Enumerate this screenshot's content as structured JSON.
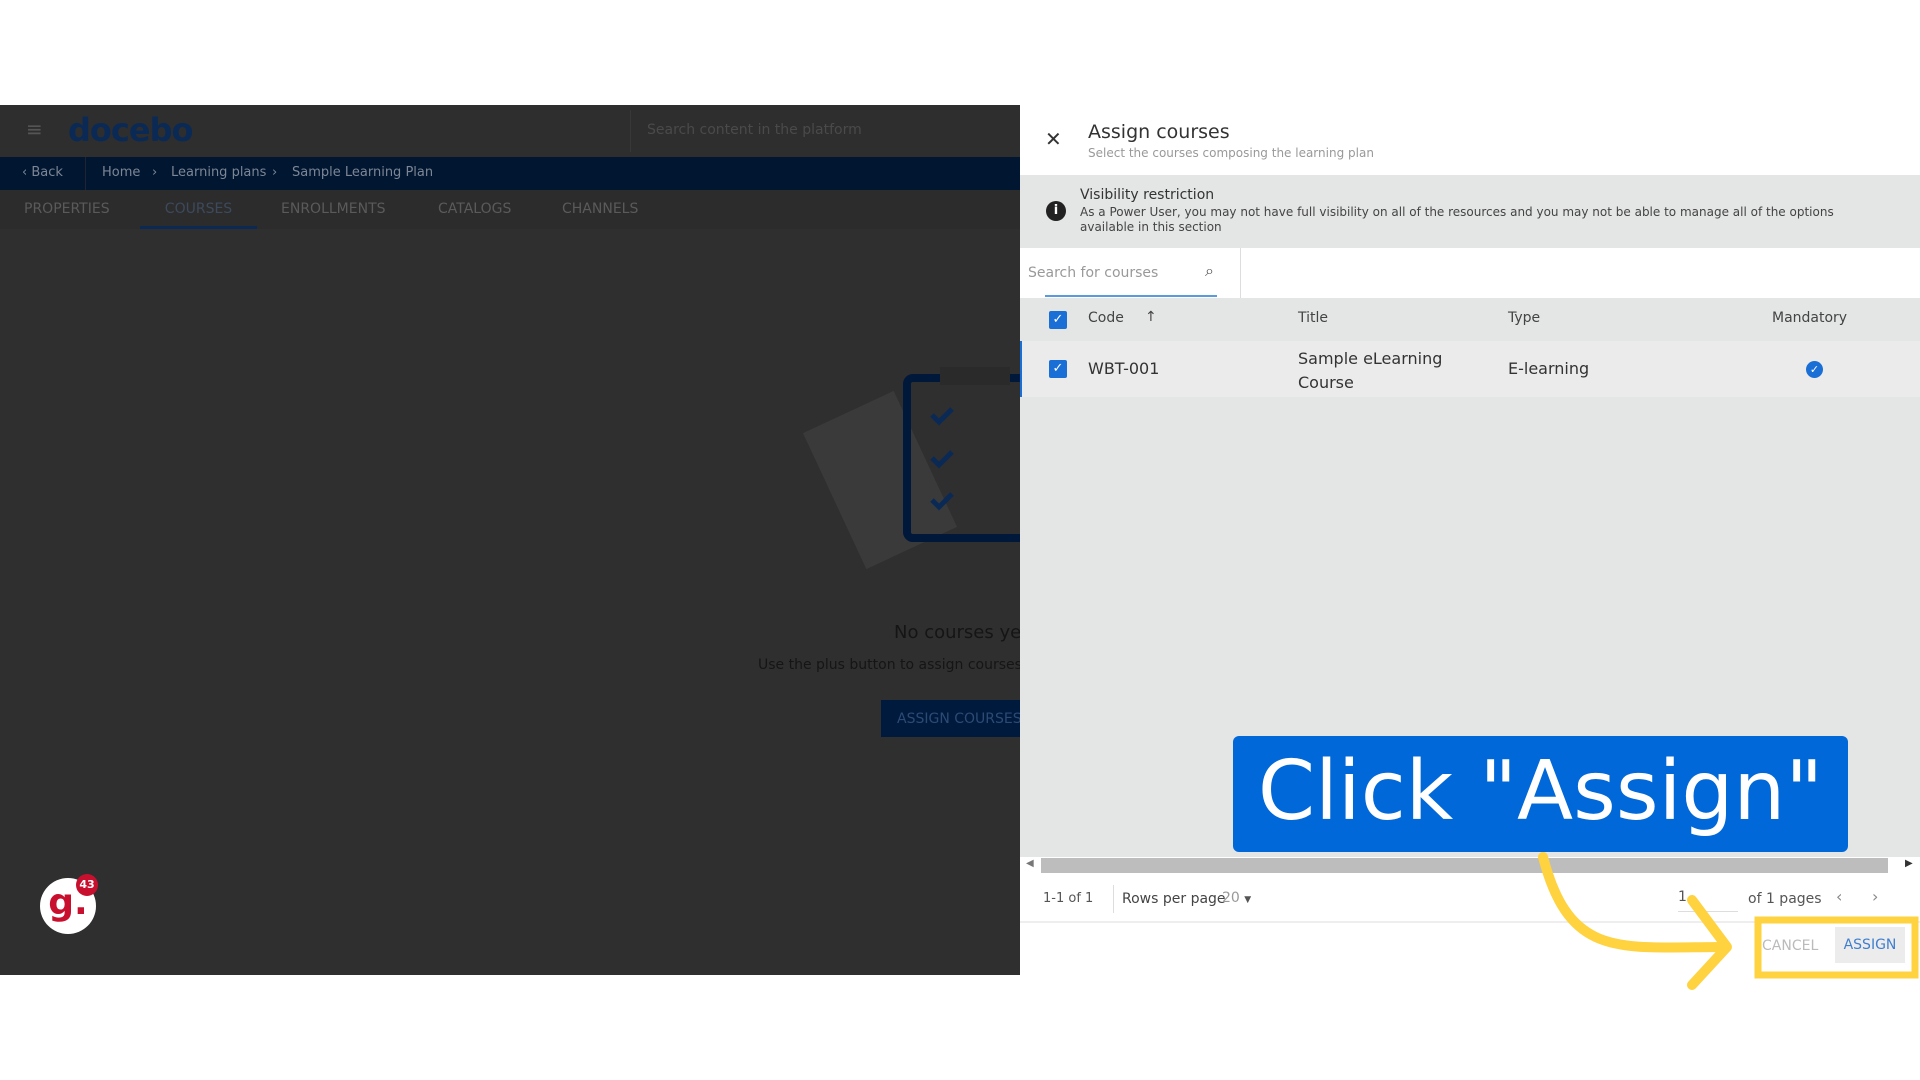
{
  "app": {
    "logo": "docebo",
    "search_placeholder": "Search content in the platform"
  },
  "breadcrumb": {
    "back": "Back",
    "items": [
      "Home",
      "Learning plans",
      "Sample Learning Plan"
    ]
  },
  "tabs": [
    "PROPERTIES",
    "COURSES",
    "ENROLLMENTS",
    "CATALOGS",
    "CHANNELS"
  ],
  "active_tab": "COURSES",
  "empty_state": {
    "title": "No courses yet",
    "subtitle": "Use the plus button to assign courses",
    "button": "ASSIGN COURSES"
  },
  "notification_badge": {
    "letter": "g.",
    "count": "43"
  },
  "panel": {
    "title": "Assign courses",
    "subtitle": "Select the courses composing the learning plan",
    "notice": {
      "title": "Visibility restriction",
      "text": "As a Power User, you may not have full visibility on all of the resources and you may not be able to manage all of the options available in this section"
    },
    "search_placeholder": "Search for courses",
    "columns": [
      "Code",
      "Title",
      "Type",
      "Mandatory"
    ],
    "rows": [
      {
        "code": "WBT-001",
        "title": "Sample eLearning Course",
        "type": "E-learning",
        "mandatory": true,
        "selected": true
      }
    ],
    "pagination": {
      "range": "1-1 of 1",
      "rows_label": "Rows per page",
      "rows_value": "20",
      "page": "1",
      "of_pages": "of 1 pages"
    },
    "cancel": "CANCEL",
    "assign": "ASSIGN"
  },
  "callout": {
    "text": "Click \"Assign\""
  },
  "colors": {
    "accent": "#1a6fd6",
    "callout": "#0068d9",
    "highlight": "#ffd23f"
  }
}
